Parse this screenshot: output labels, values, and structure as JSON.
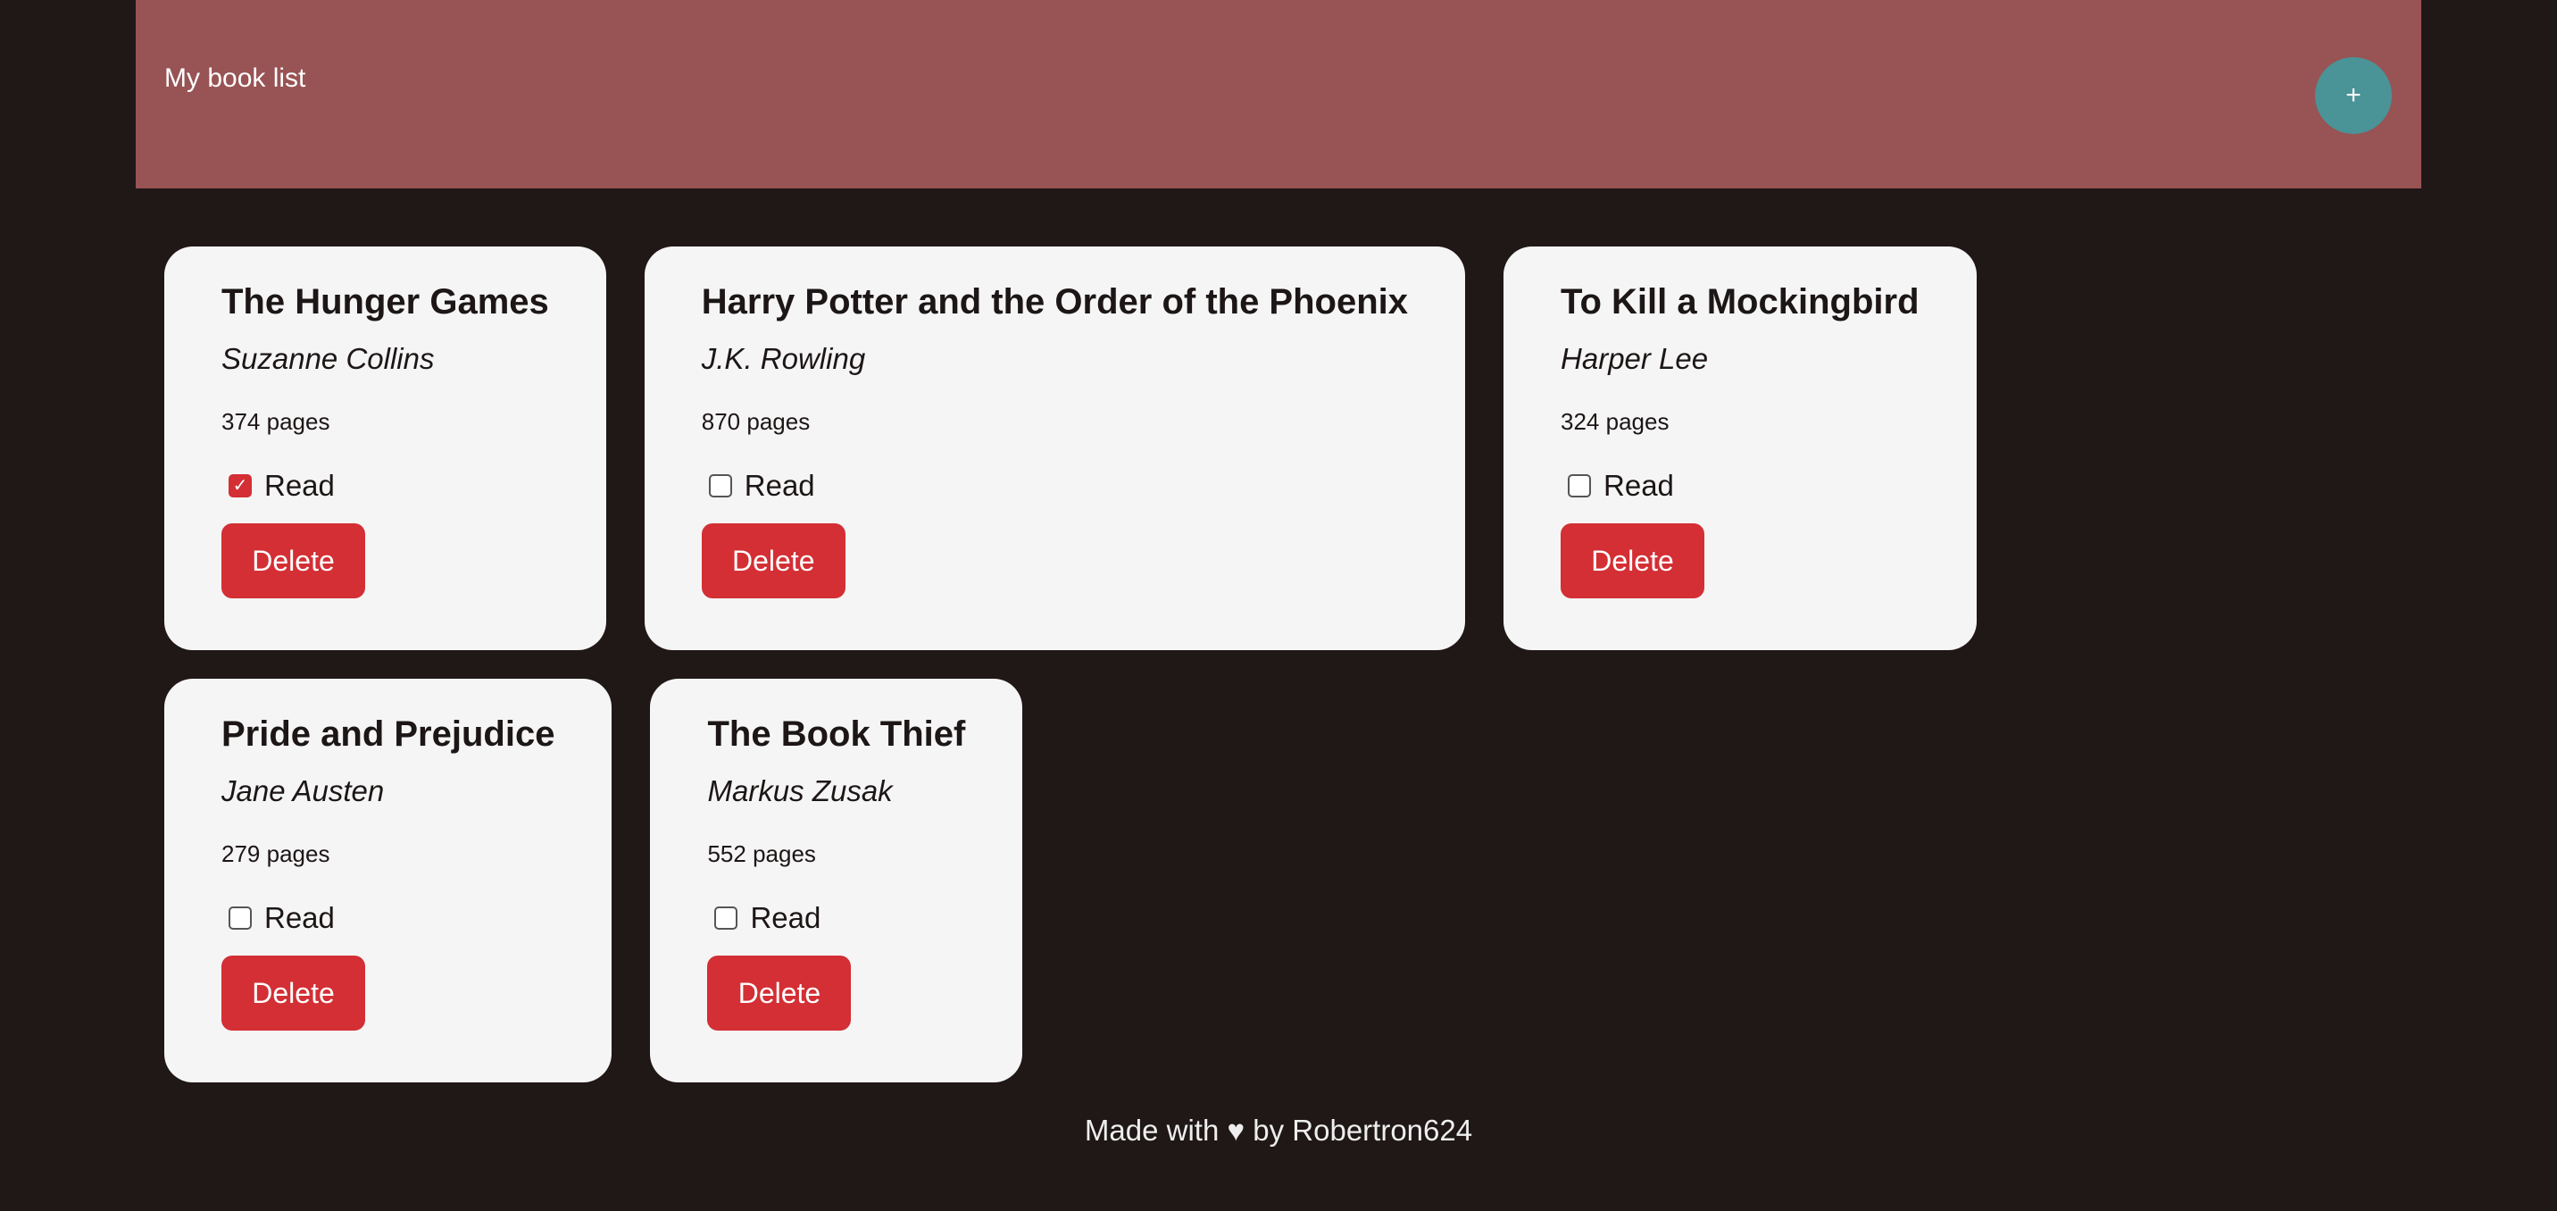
{
  "header": {
    "title": "My book list",
    "add_button_label": "+"
  },
  "books": [
    {
      "title": "The Hunger Games",
      "author": "Suzanne Collins",
      "pages": "374 pages",
      "read_label": "Read",
      "read": true,
      "delete_label": "Delete"
    },
    {
      "title": "Harry Potter and the Order of the Phoenix",
      "author": "J.K. Rowling",
      "pages": "870 pages",
      "read_label": "Read",
      "read": false,
      "delete_label": "Delete"
    },
    {
      "title": "To Kill a Mockingbird",
      "author": "Harper Lee",
      "pages": "324 pages",
      "read_label": "Read",
      "read": false,
      "delete_label": "Delete"
    },
    {
      "title": "Pride and Prejudice",
      "author": "Jane Austen",
      "pages": "279 pages",
      "read_label": "Read",
      "read": false,
      "delete_label": "Delete"
    },
    {
      "title": "The Book Thief",
      "author": "Markus Zusak",
      "pages": "552 pages",
      "read_label": "Read",
      "read": false,
      "delete_label": "Delete"
    }
  ],
  "footer": {
    "text": "Made with ♥ by Robertron624"
  },
  "colors": {
    "background": "#201717",
    "header": "#985354",
    "add_button": "#4a9396",
    "card": "#f5f5f5",
    "delete_button": "#d32f34",
    "checkbox_checked": "#d32f34"
  },
  "icons": {
    "checkmark": "check-icon"
  }
}
